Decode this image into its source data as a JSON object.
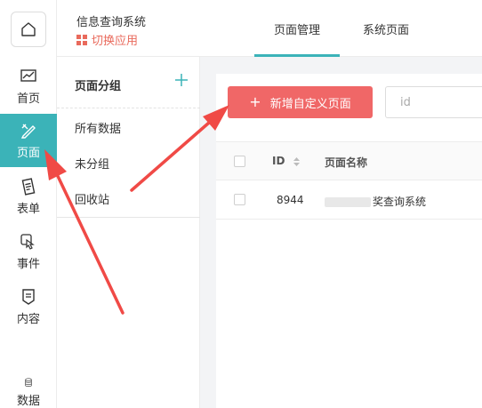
{
  "rail": {
    "items": [
      {
        "label": "首页",
        "icon": "chart-icon"
      },
      {
        "label": "页面",
        "icon": "pencil-ruler-icon"
      },
      {
        "label": "表单",
        "icon": "form-icon"
      },
      {
        "label": "事件",
        "icon": "touch-icon"
      },
      {
        "label": "内容",
        "icon": "content-icon"
      },
      {
        "label": "数据",
        "icon": "database-icon"
      }
    ]
  },
  "header": {
    "app_title": "信息查询系统",
    "switch_app": "切换应用",
    "tabs": [
      "页面管理",
      "系统页面"
    ]
  },
  "groups": {
    "title": "页面分组",
    "items": [
      "所有数据",
      "未分组",
      "回收站"
    ]
  },
  "main": {
    "new_button": "新增自定义页面",
    "id_placeholder": "id",
    "columns": [
      "ID",
      "页面名称"
    ],
    "rows": [
      {
        "id": "8944",
        "name": "奖查询系统"
      }
    ]
  },
  "colors": {
    "accent": "#3bb3b8",
    "primary_button": "#f06767",
    "switch_app": "#e96a5c",
    "annotation": "#f04a46"
  }
}
